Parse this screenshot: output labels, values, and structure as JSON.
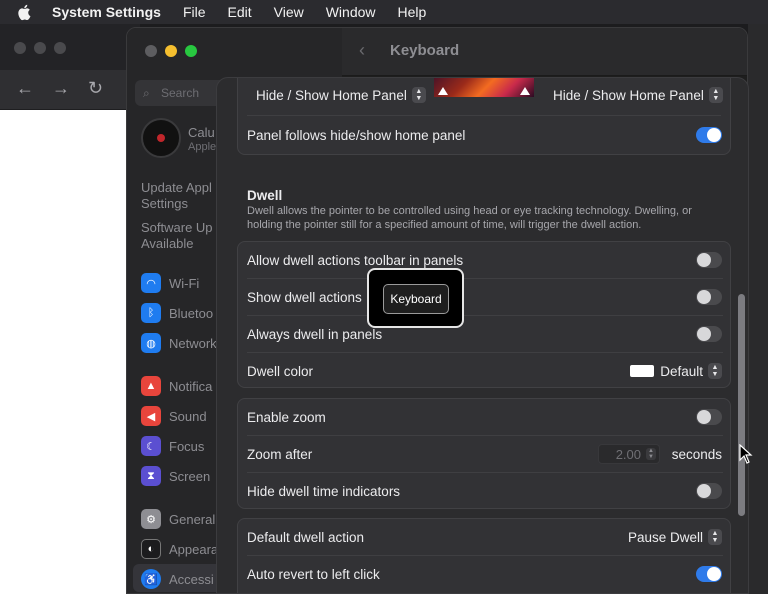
{
  "menubar": {
    "app_name": "System Settings",
    "items": [
      "File",
      "Edit",
      "View",
      "Window",
      "Help"
    ]
  },
  "window": {
    "title": "Keyboard"
  },
  "sidebar": {
    "search_placeholder": "Search",
    "account_name": "Calu",
    "account_sub": "Apple",
    "update_line1": "Update Appl",
    "update_line2": "Settings",
    "software_line1": "Software Up",
    "software_line2": "Available",
    "items": [
      {
        "label": "Wi-Fi",
        "icon": "wifi-icon",
        "color": "#1f7cf0"
      },
      {
        "label": "Bluetoo",
        "icon": "bluetooth-icon",
        "color": "#1f7cf0"
      },
      {
        "label": "Network",
        "icon": "globe-icon",
        "color": "#1f7cf0"
      },
      {
        "label": "Notifica",
        "icon": "bell-icon",
        "color": "#e8453c"
      },
      {
        "label": "Sound",
        "icon": "speaker-icon",
        "color": "#e8453c"
      },
      {
        "label": "Focus",
        "icon": "moon-icon",
        "color": "#5b4fd1"
      },
      {
        "label": "Screen",
        "icon": "hourglass-icon",
        "color": "#5b4fd1"
      },
      {
        "label": "General",
        "icon": "gear-icon",
        "color": "#8e8e93"
      },
      {
        "label": "Appeara",
        "icon": "appearance-icon",
        "color": "#1c1c1e"
      },
      {
        "label": "Accessi",
        "icon": "accessibility-icon",
        "color": "#1f7cf0"
      }
    ]
  },
  "sheet": {
    "popup_left": "Hide / Show Home Panel",
    "popup_right": "Hide / Show Home Panel",
    "panel_follows_label": "Panel follows hide/show home panel",
    "panel_follows_on": true,
    "dwell_title": "Dwell",
    "dwell_desc": "Dwell allows the pointer to be controlled using head or eye tracking technology. Dwelling, or holding the pointer still for a specified amount of time, will trigger the dwell action.",
    "dwell_rows": [
      {
        "label": "Allow dwell actions toolbar in panels",
        "on": false
      },
      {
        "label": "Show dwell actions",
        "on": false
      },
      {
        "label": "Always dwell in panels",
        "on": false
      }
    ],
    "dwell_color_label": "Dwell color",
    "dwell_color_value": "Default",
    "enable_zoom_label": "Enable zoom",
    "enable_zoom_on": false,
    "zoom_after_label": "Zoom after",
    "zoom_after_value": "2.00",
    "zoom_after_unit": "seconds",
    "hide_indicators_label": "Hide dwell time indicators",
    "hide_indicators_on": false,
    "default_action_label": "Default dwell action",
    "default_action_value": "Pause Dwell",
    "auto_revert_label": "Auto revert to left click",
    "auto_revert_on": true
  },
  "tooltip": {
    "label": "Keyboard"
  },
  "colors": {
    "accent": "#2f7bea",
    "toggle_off": "#4a4a4d"
  }
}
